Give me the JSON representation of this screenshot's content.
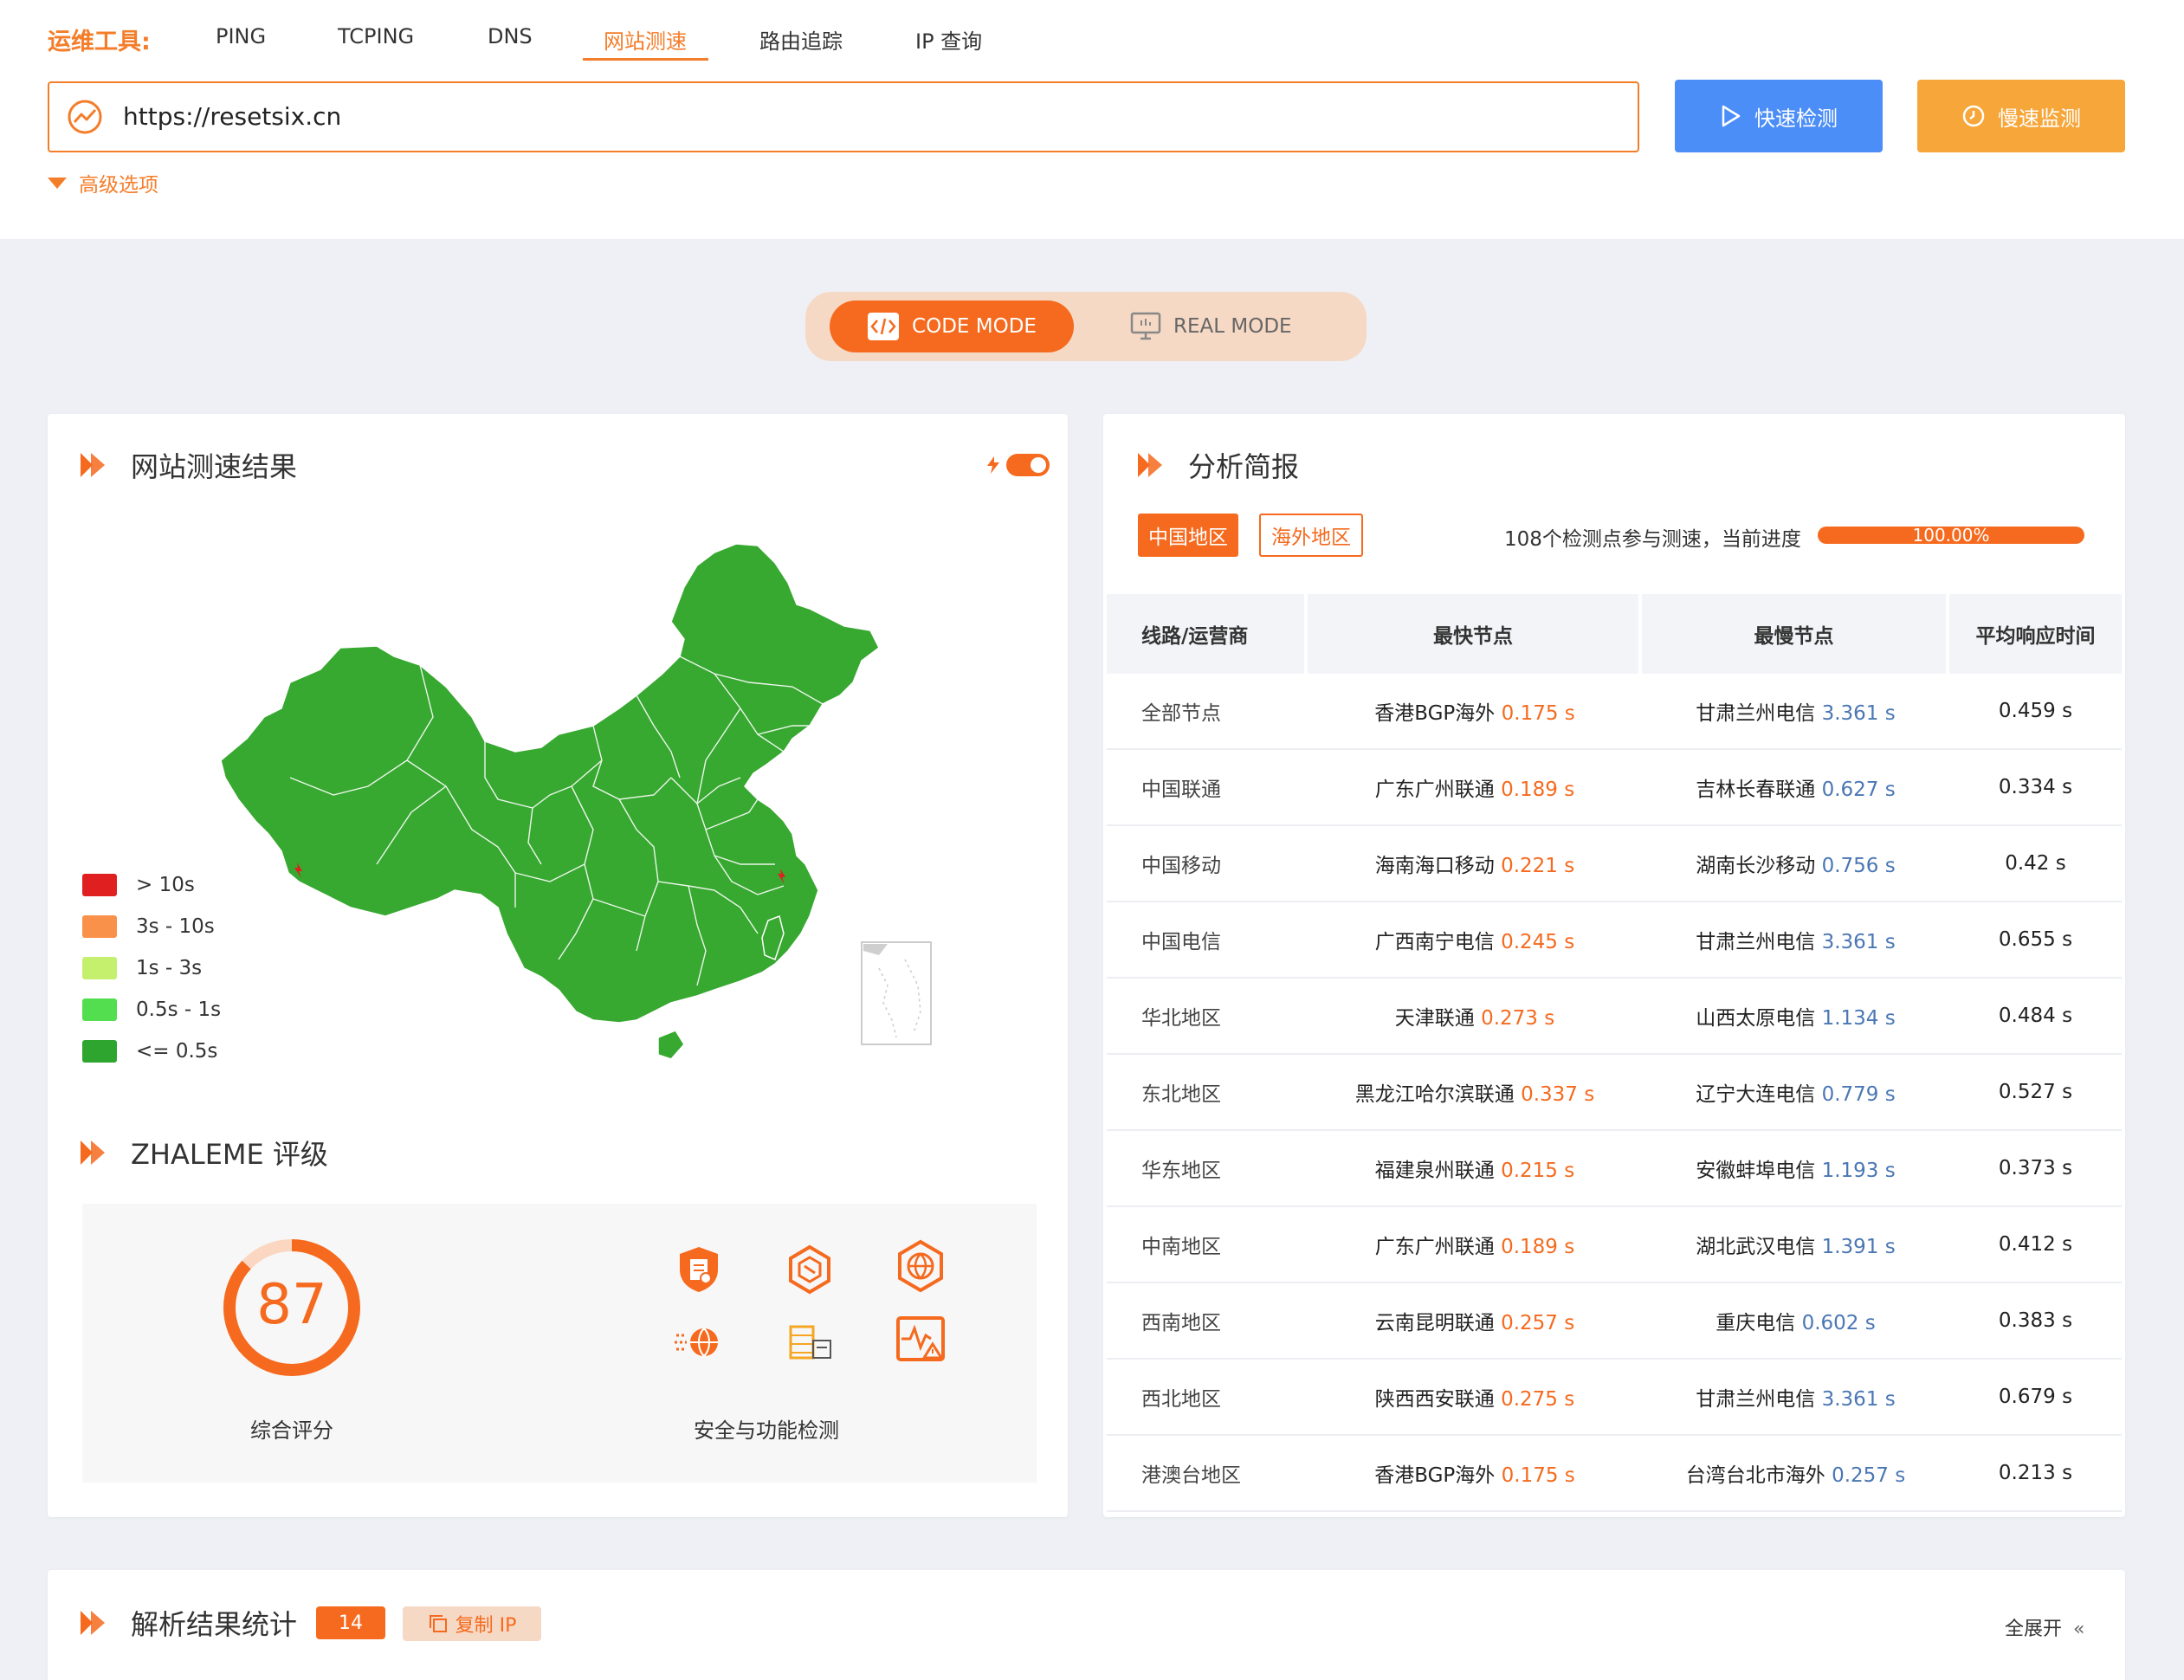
{
  "toolbar": {
    "brand": "运维工具:",
    "tabs": [
      "PING",
      "TCPING",
      "DNS",
      "网站测速",
      "路由追踪",
      "IP 查询"
    ],
    "active_tab": "网站测速",
    "url_value": "https://resetsix.cn",
    "fast_btn": "快速检测",
    "slow_btn": "慢速监测",
    "advanced": "高级选项"
  },
  "mode": {
    "active": "CODE MODE",
    "inactive": "REAL MODE"
  },
  "result": {
    "title": "网站测速结果",
    "legend": [
      {
        "label": "> 10s",
        "color": "#e02020"
      },
      {
        "label": "3s - 10s",
        "color": "#f9914b"
      },
      {
        "label": "1s - 3s",
        "color": "#c4f06e"
      },
      {
        "label": "0.5s - 1s",
        "color": "#52de4f"
      },
      {
        "label": "<= 0.5s",
        "color": "#2ea52e"
      }
    ],
    "map_color": "#37a830"
  },
  "rating": {
    "title": "ZHALEME 评级",
    "score": "87",
    "score_fraction": 0.87,
    "score_label": "综合评分",
    "security_label": "安全与功能检测"
  },
  "analysis": {
    "title": "分析简报",
    "tab_cn": "中国地区",
    "tab_overseas": "海外地区",
    "progress_text": "108个检测点参与测速，当前进度",
    "progress_value": "100.00%",
    "headers": [
      "线路/运营商",
      "最快节点",
      "最慢节点",
      "平均响应时间"
    ],
    "rows": [
      {
        "line": "全部节点",
        "fast_node": "香港BGP海外",
        "fast_time": "0.175 s",
        "slow_node": "甘肃兰州电信",
        "slow_time": "3.361 s",
        "avg": "0.459 s"
      },
      {
        "line": "中国联通",
        "fast_node": "广东广州联通",
        "fast_time": "0.189 s",
        "slow_node": "吉林长春联通",
        "slow_time": "0.627 s",
        "avg": "0.334 s"
      },
      {
        "line": "中国移动",
        "fast_node": "海南海口移动",
        "fast_time": "0.221 s",
        "slow_node": "湖南长沙移动",
        "slow_time": "0.756 s",
        "avg": "0.42 s"
      },
      {
        "line": "中国电信",
        "fast_node": "广西南宁电信",
        "fast_time": "0.245 s",
        "slow_node": "甘肃兰州电信",
        "slow_time": "3.361 s",
        "avg": "0.655 s"
      },
      {
        "line": "华北地区",
        "fast_node": "天津联通",
        "fast_time": "0.273 s",
        "slow_node": "山西太原电信",
        "slow_time": "1.134 s",
        "avg": "0.484 s"
      },
      {
        "line": "东北地区",
        "fast_node": "黑龙江哈尔滨联通",
        "fast_time": "0.337 s",
        "slow_node": "辽宁大连电信",
        "slow_time": "0.779 s",
        "avg": "0.527 s"
      },
      {
        "line": "华东地区",
        "fast_node": "福建泉州联通",
        "fast_time": "0.215 s",
        "slow_node": "安徽蚌埠电信",
        "slow_time": "1.193 s",
        "avg": "0.373 s"
      },
      {
        "line": "中南地区",
        "fast_node": "广东广州联通",
        "fast_time": "0.189 s",
        "slow_node": "湖北武汉电信",
        "slow_time": "1.391 s",
        "avg": "0.412 s"
      },
      {
        "line": "西南地区",
        "fast_node": "云南昆明联通",
        "fast_time": "0.257 s",
        "slow_node": "重庆电信",
        "slow_time": "0.602 s",
        "avg": "0.383 s"
      },
      {
        "line": "西北地区",
        "fast_node": "陕西西安联通",
        "fast_time": "0.275 s",
        "slow_node": "甘肃兰州电信",
        "slow_time": "3.361 s",
        "avg": "0.679 s"
      },
      {
        "line": "港澳台地区",
        "fast_node": "香港BGP海外",
        "fast_time": "0.175 s",
        "slow_node": "台湾台北市海外",
        "slow_time": "0.257 s",
        "avg": "0.213 s"
      }
    ]
  },
  "parse": {
    "title": "解析结果统计",
    "count": "14",
    "copy_ip": "复制 IP",
    "expand": "全展开"
  },
  "colors": {
    "accent": "#f56a1e",
    "blue": "#4c8ef7",
    "amber": "#f7a63a"
  }
}
